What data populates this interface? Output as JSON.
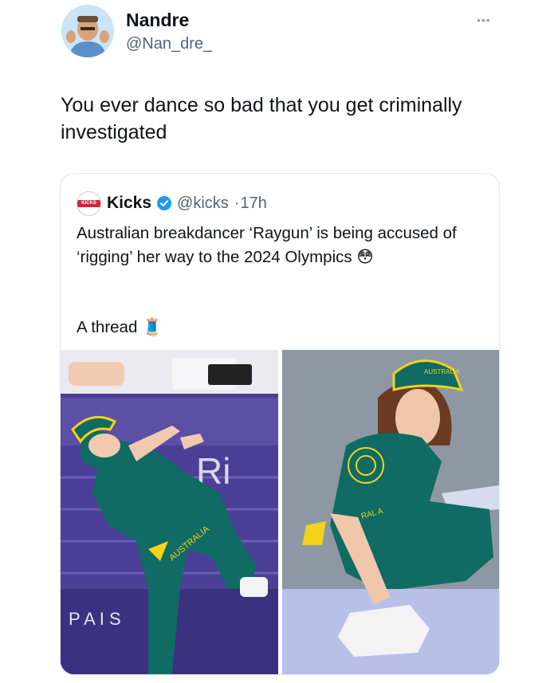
{
  "author": {
    "name": "Nandre",
    "handle": "@Nan_dre_"
  },
  "more_label": "•••",
  "tweet": {
    "text": "You ever dance so bad that you get criminally investigated"
  },
  "quote": {
    "logo_text": "KICKS",
    "name": "Kicks",
    "handle": "@kicks",
    "time": "17h",
    "text": "Australian breakdancer ‘Raygun’ is being accused of ‘rigging’ her way to the 2024 Olympics 😳",
    "thread": "A thread 🧵",
    "media_left_sign": "Ri",
    "media_left_floor": "P A I     S",
    "media_left_pants": "AUSTRALIA",
    "media_right_cap": "AUSTRALIA",
    "media_right_pants": "RAL A"
  },
  "colors": {
    "verified": "#1d9bf0",
    "kit_green": "#0f6b63",
    "kit_gold": "#f2d21b"
  }
}
